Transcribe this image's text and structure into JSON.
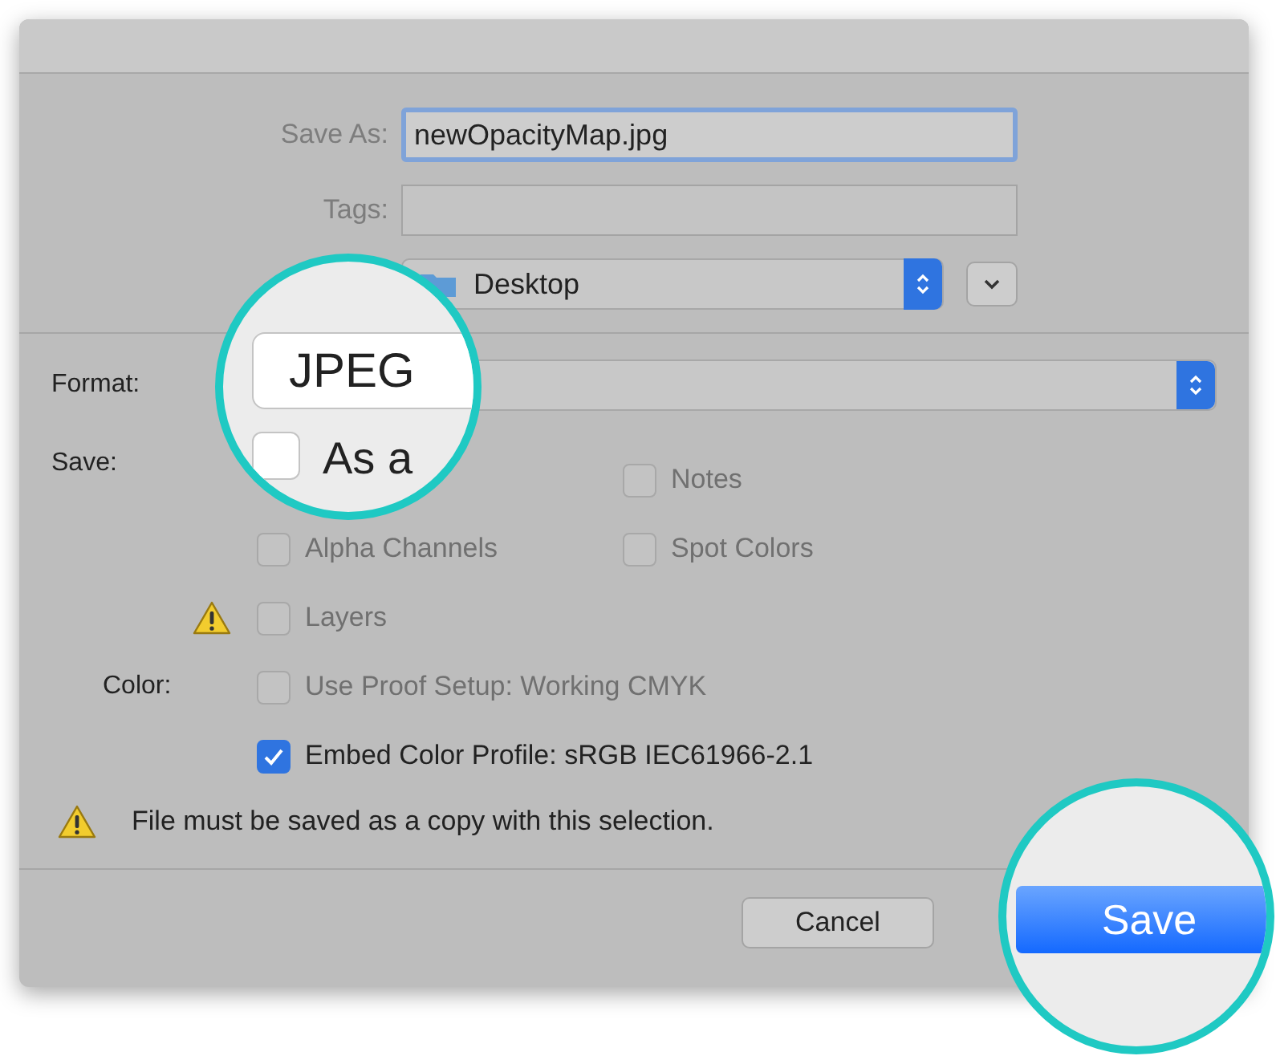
{
  "save_as": {
    "label": "Save As:",
    "value": "newOpacityMap.jpg"
  },
  "tags": {
    "label": "Tags:"
  },
  "location": {
    "value": "Desktop",
    "expanded": false
  },
  "format": {
    "label": "Format:"
  },
  "save_options": {
    "label": "Save:",
    "rows": [
      [
        null,
        {
          "label": "Notes",
          "checked": false,
          "disabled": true,
          "warning": false
        }
      ],
      [
        {
          "label": "Alpha Channels",
          "checked": false,
          "disabled": true,
          "warning": false
        },
        {
          "label": "Spot Colors",
          "checked": false,
          "disabled": true,
          "warning": false
        }
      ],
      [
        {
          "label": "Layers",
          "checked": false,
          "disabled": true,
          "warning": true
        }
      ]
    ]
  },
  "color_options": {
    "label": "Color:",
    "items": [
      {
        "label": "Use Proof Setup:  Working CMYK",
        "checked": false,
        "disabled": true
      },
      {
        "label": "Embed Color Profile:  sRGB IEC61966-2.1",
        "checked": true,
        "disabled": false
      }
    ]
  },
  "message": "File must be saved as a copy with this selection.",
  "buttons": [
    {
      "label": "Cancel",
      "kind": "normal"
    }
  ],
  "lenses": [
    {
      "format_value": "JPEG",
      "checkbox_label": "As a",
      "checkbox_checked": false
    },
    {
      "button_label": "Save"
    }
  ]
}
